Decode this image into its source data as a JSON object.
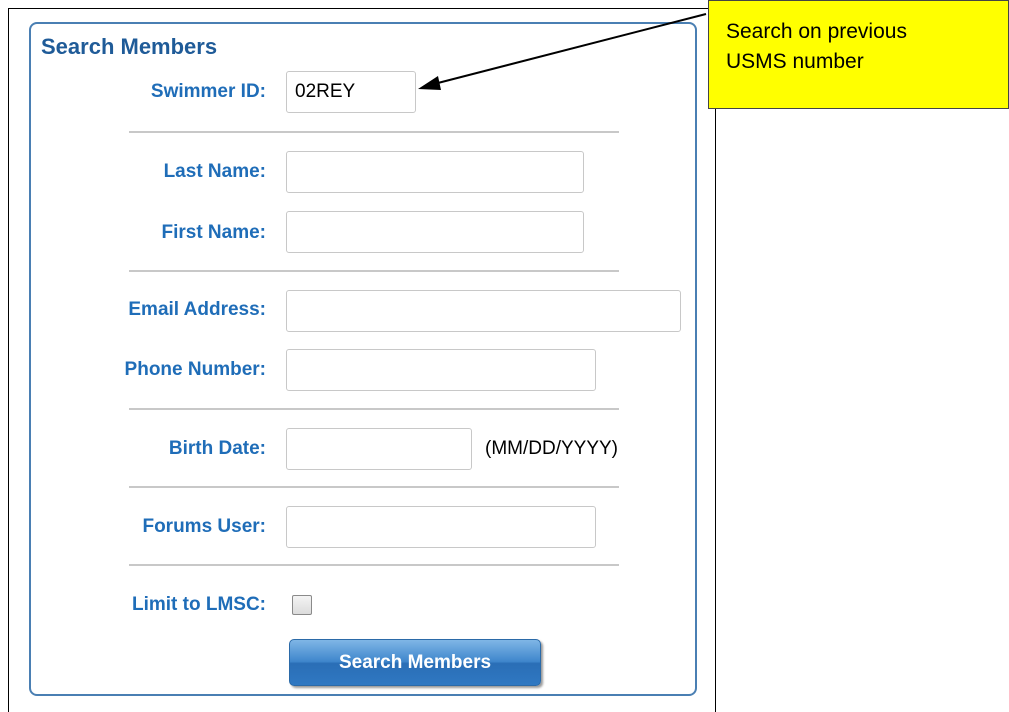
{
  "panel": {
    "title": "Search Members"
  },
  "fields": {
    "swimmer_id": {
      "label": "Swimmer ID:",
      "value": "02REY"
    },
    "last_name": {
      "label": "Last Name:",
      "value": ""
    },
    "first_name": {
      "label": "First Name:",
      "value": ""
    },
    "email": {
      "label": "Email Address:",
      "value": ""
    },
    "phone": {
      "label": "Phone Number:",
      "value": ""
    },
    "birth_date": {
      "label": "Birth Date:",
      "value": "",
      "hint": "(MM/DD/YYYY)"
    },
    "forums_user": {
      "label": "Forums User:",
      "value": ""
    },
    "limit_lmsc": {
      "label": "Limit to LMSC:",
      "checked": false
    }
  },
  "submit": {
    "label": "Search Members"
  },
  "callout": {
    "line1": "Search on previous",
    "line2": "USMS number",
    "color": "#ffff00"
  },
  "colors": {
    "label_blue": "#1f6db8",
    "title_blue": "#1f5b98",
    "border_blue": "#4a7fb3"
  }
}
